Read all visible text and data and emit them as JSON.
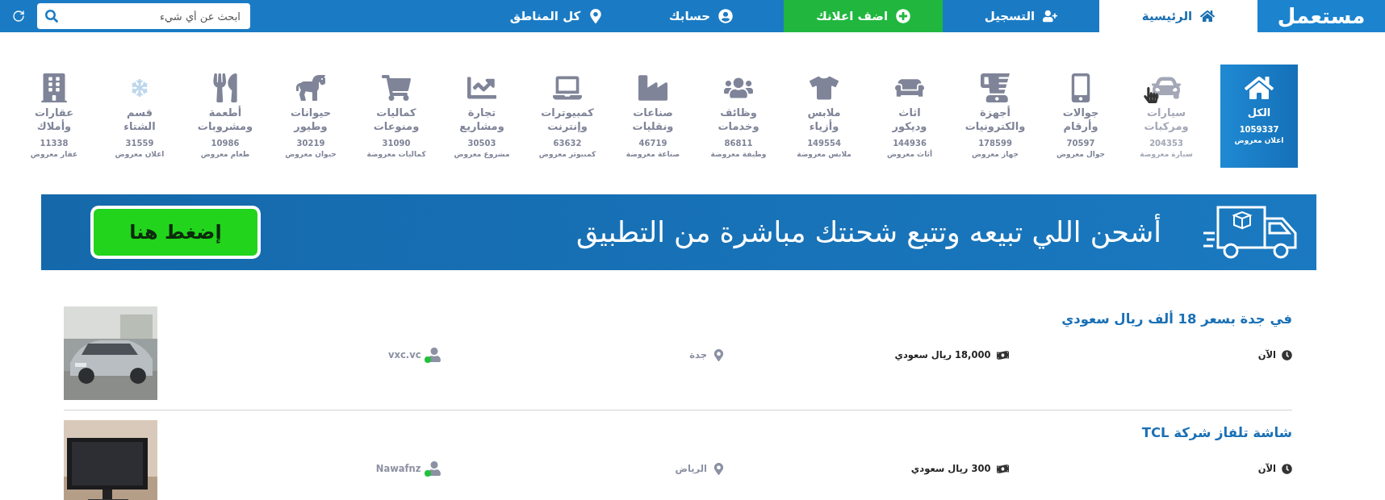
{
  "nav": {
    "logo": "مستعمل",
    "items": [
      {
        "label": "الرئيسية",
        "kind": "home",
        "selected": true
      },
      {
        "label": "التسجيل",
        "kind": "register",
        "selected": false
      },
      {
        "label": "اضف اعلانك",
        "kind": "add",
        "selected": false
      },
      {
        "label": "حسابك",
        "kind": "account",
        "selected": false
      },
      {
        "label": "كل المناطق",
        "kind": "regions",
        "selected": false
      }
    ],
    "search": {
      "placeholder": "ابحث عن أي شيء"
    }
  },
  "categories": [
    {
      "title": "الكل",
      "count": "1059337",
      "subtitle": "اعلان معروض",
      "selected": true,
      "hovered": false
    },
    {
      "title": "سيارات\nومركبات",
      "count": "204353",
      "subtitle": "سيارة معروضة",
      "selected": false,
      "hovered": true
    },
    {
      "title": "جوالات\nوأرقام",
      "count": "70597",
      "subtitle": "جوال معروض",
      "selected": false,
      "hovered": false
    },
    {
      "title": "أجهزة\nوالكترونيات",
      "count": "178599",
      "subtitle": "جهاز معروض",
      "selected": false,
      "hovered": false
    },
    {
      "title": "اثاث\nوديكور",
      "count": "144936",
      "subtitle": "أثاث معروض",
      "selected": false,
      "hovered": false
    },
    {
      "title": "ملابس\nوأزياء",
      "count": "149554",
      "subtitle": "ملابس معروضة",
      "selected": false,
      "hovered": false
    },
    {
      "title": "وظائف\nوخدمات",
      "count": "86811",
      "subtitle": "وظيفة معروضة",
      "selected": false,
      "hovered": false
    },
    {
      "title": "صناعات\nونقليات",
      "count": "46719",
      "subtitle": "صناعة معروضة",
      "selected": false,
      "hovered": false
    },
    {
      "title": "كمبيوترات\nوإنترنت",
      "count": "63632",
      "subtitle": "كمبيوتر معروض",
      "selected": false,
      "hovered": false
    },
    {
      "title": "تجارة\nومشاريع",
      "count": "30503",
      "subtitle": "مشروع معروض",
      "selected": false,
      "hovered": false
    },
    {
      "title": "كماليات\nومنوعات",
      "count": "31090",
      "subtitle": "كماليات معروضة",
      "selected": false,
      "hovered": false
    },
    {
      "title": "حيوانات\nوطيور",
      "count": "30219",
      "subtitle": "حيوان معروض",
      "selected": false,
      "hovered": false
    },
    {
      "title": "أطعمة\nومشروبات",
      "count": "10986",
      "subtitle": "طعام معروض",
      "selected": false,
      "hovered": false
    },
    {
      "title": "قسم\nالشتاء",
      "count": "31559",
      "subtitle": "اعلان معروض",
      "selected": false,
      "hovered": false
    },
    {
      "title": "عقارات\nوأملاك",
      "count": "11338",
      "subtitle": "عقار معروض",
      "selected": false,
      "hovered": false
    }
  ],
  "banner": {
    "headline": "أشحن اللي تبيعه وتتبع شحنتك مباشرة من التطبيق",
    "button": "إضغط هنا"
  },
  "listings": [
    {
      "title": "في جدة بسعر 18 ألف ريال سعودي",
      "time": "الآن",
      "price": "18,000 ريال سعودي",
      "location": "جدة",
      "user": "vxc.vc",
      "online": true
    },
    {
      "title": "شاشة تلفاز شركة TCL",
      "time": "الآن",
      "price": "300 ريال سعودي",
      "location": "الرياض",
      "user": "Nawafnz",
      "online": true
    }
  ]
}
